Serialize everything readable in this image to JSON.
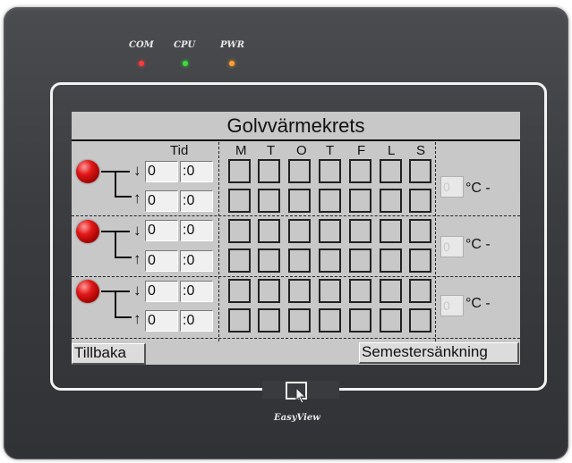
{
  "device": {
    "indicators": [
      {
        "label": "COM",
        "color": "#ff3b3b"
      },
      {
        "label": "CPU",
        "color": "#3cdc3c"
      },
      {
        "label": "PWR",
        "color": "#ffa030"
      }
    ],
    "brand": "EasyView"
  },
  "screen": {
    "title": "Golvvärmekrets",
    "time_header": "Tid",
    "days": [
      "M",
      "T",
      "O",
      "T",
      "F",
      "L",
      "S"
    ],
    "circuits": [
      {
        "on_hour": "0",
        "on_min": ":0",
        "off_hour": "0",
        "off_min": ":0",
        "temp": "0",
        "unit": "°C -"
      },
      {
        "on_hour": "0",
        "on_min": ":0",
        "off_hour": "0",
        "off_min": ":0",
        "temp": "0",
        "unit": "°C -"
      },
      {
        "on_hour": "0",
        "on_min": ":0",
        "off_hour": "0",
        "off_min": ":0",
        "temp": "0",
        "unit": "°C -"
      }
    ],
    "back_button": "Tillbaka",
    "vacation_button": "Semestersänkning"
  }
}
